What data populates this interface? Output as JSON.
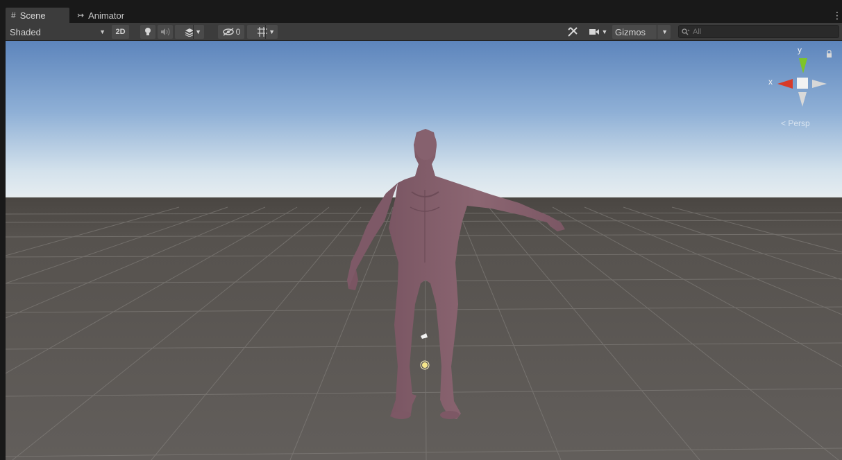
{
  "tabs": [
    {
      "label": "Scene",
      "icon": "grid-hash-icon",
      "active": true
    },
    {
      "label": "Animator",
      "icon": "animator-icon",
      "active": false
    }
  ],
  "toolbar": {
    "draw_mode": "Shaded",
    "toggle_2d": "2D",
    "hidden_count": "0",
    "gizmos_label": "Gizmos",
    "search_placeholder": "All"
  },
  "gizmo": {
    "axis_y": "y",
    "axis_x": "x",
    "projection": "Persp"
  },
  "colors": {
    "tab_bg": "#191919",
    "toolbar_bg": "#3c3c3c",
    "sky_top": "#5f86bd",
    "sky_horizon": "#e2ecf2",
    "ground": "#5e5a56",
    "character": "#8a6470",
    "axis_x": "#d83a28",
    "axis_y": "#7ec42a"
  }
}
